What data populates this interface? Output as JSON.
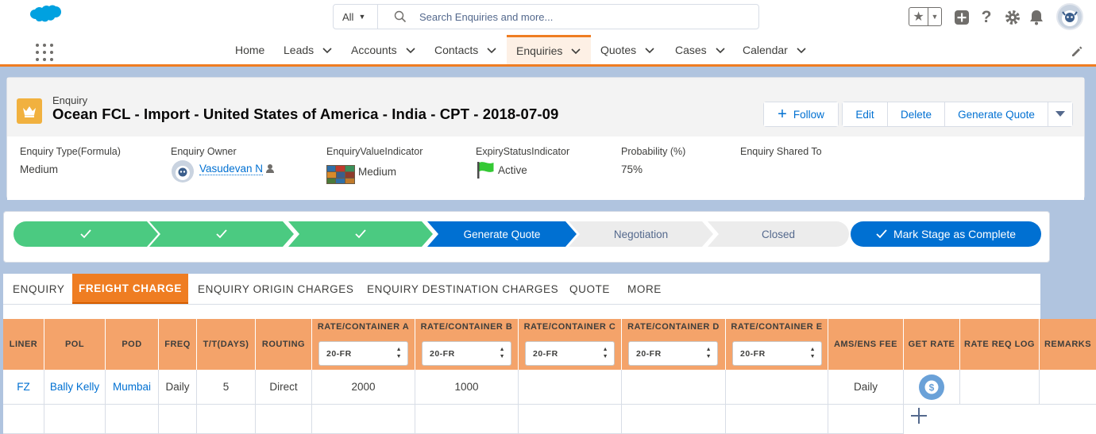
{
  "header": {
    "search_scope": "All",
    "search_placeholder": "Search Enquiries and more..."
  },
  "nav": {
    "items": [
      {
        "label": "Home",
        "dropdown": false
      },
      {
        "label": "Leads",
        "dropdown": true
      },
      {
        "label": "Accounts",
        "dropdown": true
      },
      {
        "label": "Contacts",
        "dropdown": true
      },
      {
        "label": "Enquiries",
        "dropdown": true,
        "active": true
      },
      {
        "label": "Quotes",
        "dropdown": true
      },
      {
        "label": "Cases",
        "dropdown": true
      },
      {
        "label": "Calendar",
        "dropdown": true
      }
    ]
  },
  "record": {
    "object_label": "Enquiry",
    "title": "Ocean FCL - Import - United States of America - India - CPT - 2018-07-09",
    "buttons": {
      "follow": "Follow",
      "edit": "Edit",
      "delete": "Delete",
      "generate_quote": "Generate Quote"
    },
    "fields": {
      "type_label": "Enquiry Type(Formula)",
      "type_value": "Medium",
      "owner_label": "Enquiry Owner",
      "owner_value": "Vasudevan N",
      "value_indicator_label": "EnquiryValueIndicator",
      "value_indicator_value": "Medium",
      "expiry_label": "ExpiryStatusIndicator",
      "expiry_value": "Active",
      "probability_label": "Probability (%)",
      "probability_value": "75%",
      "shared_label": "Enquiry Shared To",
      "shared_value": ""
    }
  },
  "path": {
    "stages": [
      {
        "label": "",
        "status": "complete"
      },
      {
        "label": "",
        "status": "complete"
      },
      {
        "label": "",
        "status": "complete"
      },
      {
        "label": "Generate Quote",
        "status": "current"
      },
      {
        "label": "Negotiation",
        "status": "incomplete"
      },
      {
        "label": "Closed",
        "status": "incomplete"
      }
    ],
    "mark_complete": "Mark Stage as Complete"
  },
  "tabs": [
    {
      "label": "ENQUIRY",
      "active": false
    },
    {
      "label": "FREIGHT CHARGE",
      "active": true
    },
    {
      "label": "ENQUIRY ORIGIN CHARGES",
      "active": false
    },
    {
      "label": "ENQUIRY DESTINATION CHARGES",
      "active": false
    },
    {
      "label": "QUOTE",
      "active": false
    },
    {
      "label": "MORE",
      "active": false
    }
  ],
  "freight_table": {
    "headers": {
      "liner": "LINER",
      "pol": "POL",
      "pod": "POD",
      "freq": "FREQ",
      "tt": "T/T(DAYS)",
      "routing": "ROUTING",
      "rate_a": "RATE/CONTAINER A",
      "rate_b": "RATE/CONTAINER B",
      "rate_c": "RATE/CONTAINER C",
      "rate_d": "RATE/CONTAINER D",
      "rate_e": "RATE/CONTAINER E",
      "ams": "AMS/ENS FEE",
      "get_rate": "GET RATE",
      "log": "RATE REQ LOG",
      "remarks": "REMARKS"
    },
    "container_selects": {
      "a": "20-FR",
      "b": "20-FR",
      "c": "20-FR",
      "d": "20-FR",
      "e": "20-FR"
    },
    "rows": [
      {
        "liner": "FZ",
        "pol": "Bally Kelly",
        "pod": "Mumbai",
        "freq": "Daily",
        "tt": "5",
        "routing": "Direct",
        "rate_a": "2000",
        "rate_b": "1000",
        "rate_c": "",
        "rate_d": "",
        "rate_e": "",
        "ams": "Daily",
        "log": "",
        "remarks": ""
      }
    ]
  },
  "colors": {
    "brand_blue": "#0070d2",
    "complete_green": "#4bca81",
    "accent_orange": "#ef7d22",
    "header_orange": "#f4a36a"
  }
}
